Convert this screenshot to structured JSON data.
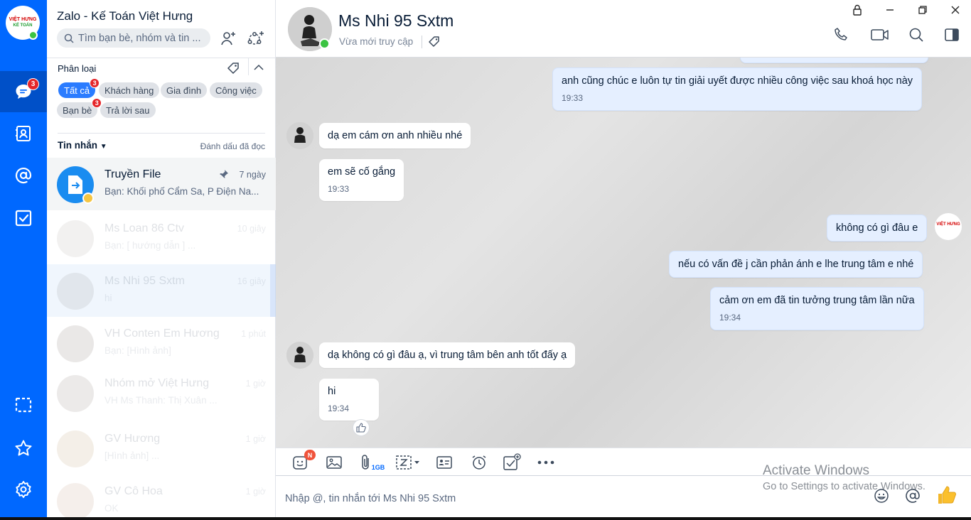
{
  "app": {
    "title": "Zalo - Kế Toán Việt Hưng",
    "brand_line1": "VIỆT HƯNG",
    "brand_line2": "KẾ TOÁN"
  },
  "rail": {
    "messages_badge": "3"
  },
  "sidebar": {
    "search_placeholder": "Tìm bạn bè, nhóm và tin ...",
    "category_label": "Phân loại",
    "chips": [
      {
        "label": "Tất cả",
        "badge": "3"
      },
      {
        "label": "Khách hàng"
      },
      {
        "label": "Gia đình"
      },
      {
        "label": "Công việc"
      },
      {
        "label": "Bạn bè",
        "badge": "3"
      },
      {
        "label": "Trả lời sau"
      }
    ],
    "messages_label": "Tin nhắn",
    "mark_read": "Đánh dấu đã đọc",
    "conversations": [
      {
        "name": "Truyền File",
        "preview": "Bạn: Khối phố Cẩm Sa, P Điện Na...",
        "time": "7 ngày"
      },
      {
        "name": "Ms Loan 86 Ctv",
        "preview": "Bạn: [ hướng dẫn ] ...",
        "time": "10 giây"
      },
      {
        "name": "Ms Nhi 95 Sxtm",
        "preview": "hi",
        "time": "16 giây"
      },
      {
        "name": "VH Conten Em Hương",
        "preview": "Bạn: [Hình ảnh]",
        "time": "1 phút"
      },
      {
        "name": "Nhóm mở Việt Hưng",
        "preview": "VH Ms Thanh: Thị Xuân ...",
        "time": "1 giờ"
      },
      {
        "name": "GV Hương",
        "preview": "[Hình ảnh] ...",
        "time": "1 giờ"
      },
      {
        "name": "GV Cô Hoa",
        "preview": "OK",
        "time": "1 giờ"
      }
    ]
  },
  "chat": {
    "contact_name": "Ms Nhi 95 Sxtm",
    "status": "Vừa mới truy cập",
    "messages": [
      {
        "dir": "out",
        "text": "anh cũng chúc e luôn tự tin giải uyết được nhiều công việc sau khoá học này",
        "time": "19:33"
      },
      {
        "dir": "in",
        "text": "dạ em cám ơn anh nhiều nhé"
      },
      {
        "dir": "in",
        "text": "em sẽ cố gắng",
        "time": "19:33"
      },
      {
        "dir": "out",
        "text": "không có gì đâu e"
      },
      {
        "dir": "out",
        "text": "nếu có vấn đề j cần phản ánh e lhe trung tâm e nhé"
      },
      {
        "dir": "out",
        "text": "cảm ơn em đã tin tưởng trung tâm lần nữa",
        "time": "19:34"
      },
      {
        "dir": "in",
        "text": "dạ không có gì đâu ạ, vì trung tâm bên anh tốt đấy ạ"
      },
      {
        "dir": "in",
        "text": "hi",
        "time": "19:34"
      }
    ],
    "sticker_badge": "N",
    "file_size_label": "1GB",
    "input_placeholder": "Nhập @, tin nhắn tới Ms Nhi 95 Sxtm"
  },
  "watermark": {
    "line1": "Activate Windows",
    "line2": "Go to Settings to activate Windows."
  },
  "colors": {
    "accent": "#0068ff",
    "outgoing_bubble": "#e5efff",
    "badge": "#e5262a",
    "online": "#3bc342"
  }
}
